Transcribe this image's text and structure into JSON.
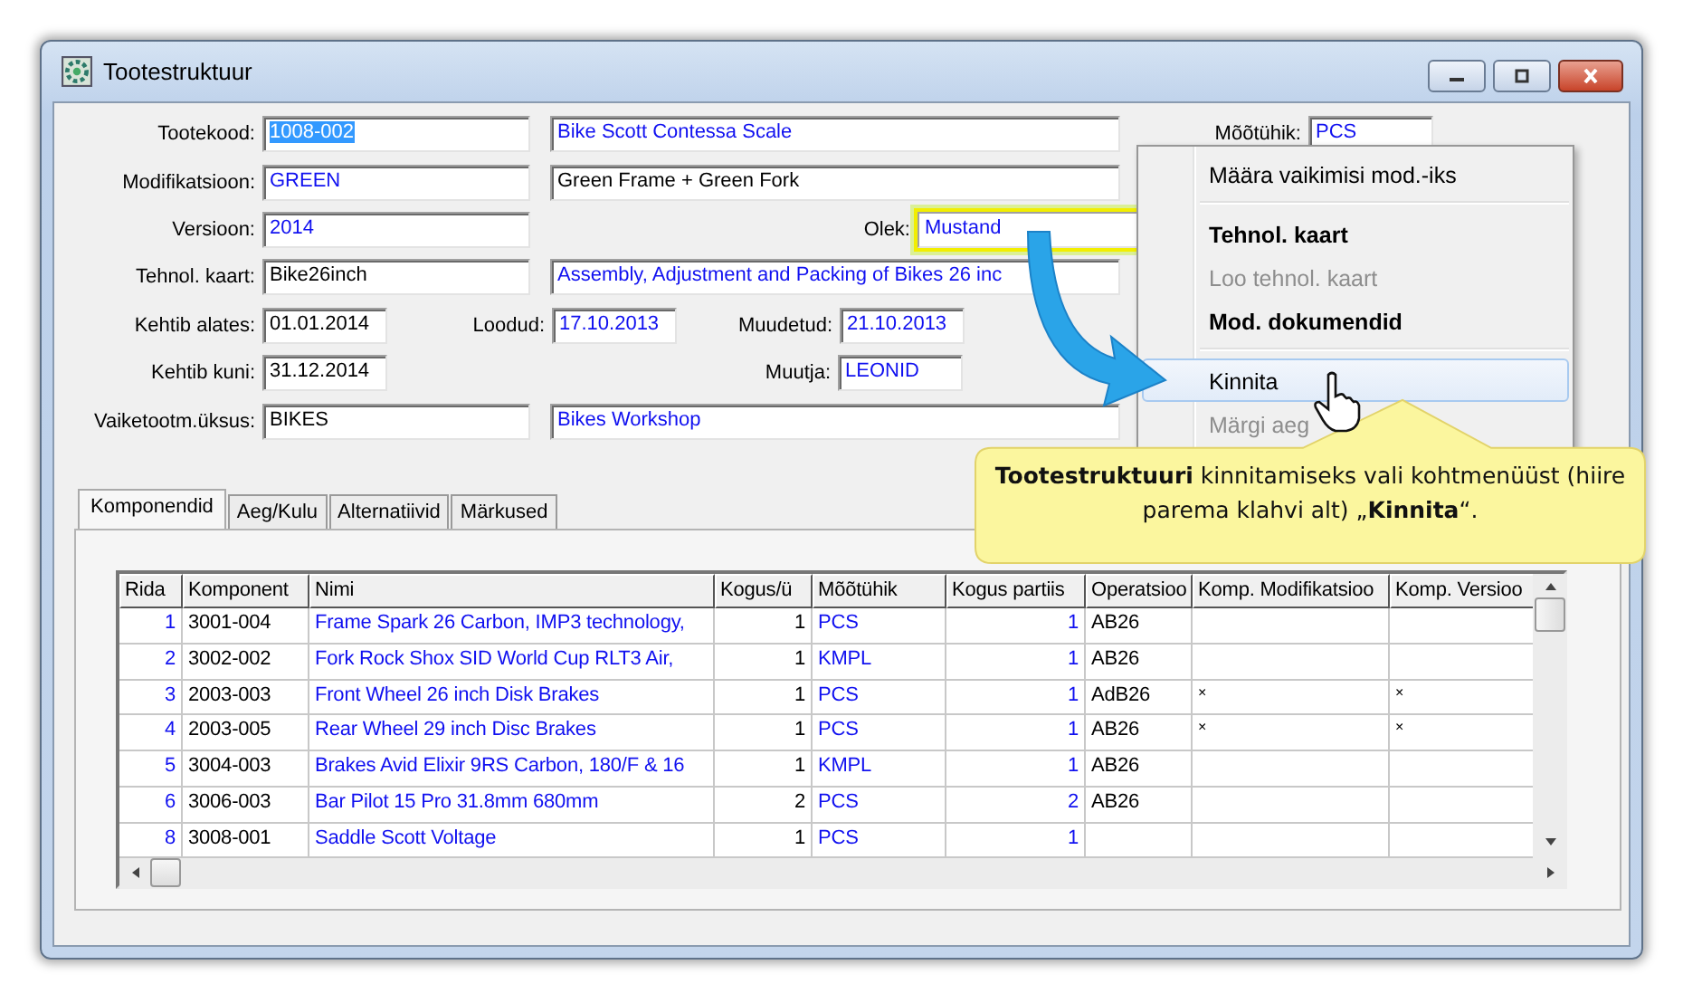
{
  "window": {
    "title": "Tootestruktuur"
  },
  "form": {
    "product_code": {
      "label": "Tootekood:",
      "value": "1008-002",
      "selected": true
    },
    "product_name": {
      "value": "Bike Scott Contessa Scale",
      "linked": true
    },
    "unit": {
      "label": "Mõõtühik:",
      "value": "PCS",
      "linked": true
    },
    "modification": {
      "label": "Modifikatsioon:",
      "value": "GREEN",
      "linked": true
    },
    "modification_name": {
      "value": "Green Frame + Green Fork",
      "linked": false
    },
    "version": {
      "label": "Versioon:",
      "value": "2014",
      "linked": true
    },
    "status": {
      "label": "Olek:",
      "value": "Mustand",
      "linked": true,
      "highlighted": true
    },
    "tech_card": {
      "label": "Tehnol. kaart:",
      "value": "Bike26inch",
      "linked": false
    },
    "tech_card_name": {
      "value": "Assembly, Adjustment and Packing of Bikes 26 inc",
      "linked": true
    },
    "valid_from": {
      "label": "Kehtib alates:",
      "value": "01.01.2014",
      "linked": false
    },
    "created": {
      "label": "Loodud:",
      "value": "17.10.2013",
      "linked": true
    },
    "modified": {
      "label": "Muudetud:",
      "value": "21.10.2013",
      "linked": true
    },
    "valid_to": {
      "label": "Kehtib kuni:",
      "value": "31.12.2014",
      "linked": false
    },
    "modifier": {
      "label": "Muutja:",
      "value": "LEONID",
      "linked": true
    },
    "default_unit": {
      "label": "Vaiketootm.üksus:",
      "value": "BIKES",
      "linked": false
    },
    "default_unit_name": {
      "value": "Bikes Workshop",
      "linked": true
    }
  },
  "tabs": [
    {
      "label": "Komponendid",
      "selected": true
    },
    {
      "label": "Aeg/Kulu",
      "selected": false
    },
    {
      "label": "Alternatiivid",
      "selected": false
    },
    {
      "label": "Märkused",
      "selected": false
    }
  ],
  "table": {
    "columns": [
      {
        "label": "Rida",
        "kind": "number",
        "linked": true
      },
      {
        "label": "Komponent",
        "kind": "text",
        "linked": false
      },
      {
        "label": "Nimi",
        "kind": "text",
        "linked": true
      },
      {
        "label": "Kogus/ü",
        "kind": "number",
        "linked": false
      },
      {
        "label": "Mõõtühik",
        "kind": "text",
        "linked": true
      },
      {
        "label": "Kogus partiis",
        "kind": "number",
        "linked": true
      },
      {
        "label": "Operatsioo",
        "kind": "text",
        "linked": false
      },
      {
        "label": "Komp. Modifikatsioo",
        "kind": "text",
        "linked": false
      },
      {
        "label": "Komp. Versioo",
        "kind": "text",
        "linked": false
      }
    ],
    "rows": [
      [
        "1",
        "3001-004",
        "Frame Spark 26 Carbon, IMP3 technology,",
        "1",
        "PCS",
        "1",
        "AB26"
      ],
      [
        "2",
        "3002-002",
        "Fork Rock Shox SID World Cup RLT3 Air,",
        "1",
        "KMPL",
        "1",
        "AB26"
      ],
      [
        "3",
        "2003-003",
        "Front Wheel 26 inch Disk Brakes",
        "1",
        "PCS",
        "1",
        "AdB26",
        "×",
        "×"
      ],
      [
        "4",
        "2003-005",
        "Rear Wheel 29 inch Disc Brakes",
        "1",
        "PCS",
        "1",
        "AB26",
        "×",
        "×"
      ],
      [
        "5",
        "3004-003",
        "Brakes Avid Elixir 9RS Carbon, 180/F & 16",
        "1",
        "KMPL",
        "1",
        "AB26"
      ],
      [
        "6",
        "3006-003",
        "Bar Pilot 15 Pro 31.8mm 680mm",
        "2",
        "PCS",
        "2",
        "AB26"
      ],
      [
        "8",
        "3008-001",
        "Saddle Scott Voltage",
        "1",
        "PCS",
        "1"
      ]
    ]
  },
  "context_menu": [
    {
      "kind": "item",
      "label": "Määra vaikimisi mod.-iks",
      "bold": false,
      "disabled": false,
      "selected": false
    },
    {
      "kind": "separator"
    },
    {
      "kind": "item",
      "label": "Tehnol. kaart",
      "bold": true,
      "disabled": false,
      "selected": false
    },
    {
      "kind": "item",
      "label": "Loo tehnol. kaart",
      "bold": false,
      "disabled": true,
      "selected": false
    },
    {
      "kind": "item",
      "label": "Mod. dokumendid",
      "bold": true,
      "disabled": false,
      "selected": false
    },
    {
      "kind": "separator"
    },
    {
      "kind": "item",
      "label": "Kinnita",
      "bold": false,
      "disabled": false,
      "selected": true
    },
    {
      "kind": "item",
      "label": "Märgi aeg",
      "bold": false,
      "disabled": true,
      "selected": false
    }
  ],
  "callout": {
    "text": "**Tootestruktuuri** kinnitamiseks vali kohtmenüüst (hiire parema klahvi alt) „**Kinnita**“."
  }
}
